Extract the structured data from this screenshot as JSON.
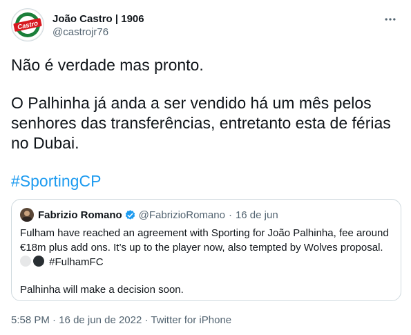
{
  "tweet": {
    "author": {
      "display_name": "João Castro | 1906",
      "handle": "@castrojr76",
      "avatar_text": "Castro"
    },
    "paragraphs": [
      "Não é verdade mas pronto.",
      "O Palhinha já anda a ser vendido há um mês pelos senhores das transferências, entretanto esta de férias no Dubai."
    ],
    "hashtag": "#SportingCP",
    "meta": {
      "time": "5:58 PM",
      "separator": "·",
      "date": "16 de jun de 2022",
      "source": "Twitter for iPhone"
    }
  },
  "quoted_tweet": {
    "display_name": "Fabrizio Romano",
    "handle": "@FabrizioRomano",
    "separator": "·",
    "date": "16 de jun",
    "line1": "Fulham have reached an agreement with Sporting for João Palhinha, fee around €18m plus add ons. It’s up to the player now, also tempted by Wolves proposal.",
    "hashtag": "#FulhamFC",
    "line2": "Palhinha will make a decision soon."
  },
  "colors": {
    "link": "#1d9bf0",
    "text": "#0f1419",
    "secondary": "#536471",
    "border": "#cfd9de",
    "castro_green": "#1b7f3a",
    "castro_red": "#d71920"
  }
}
